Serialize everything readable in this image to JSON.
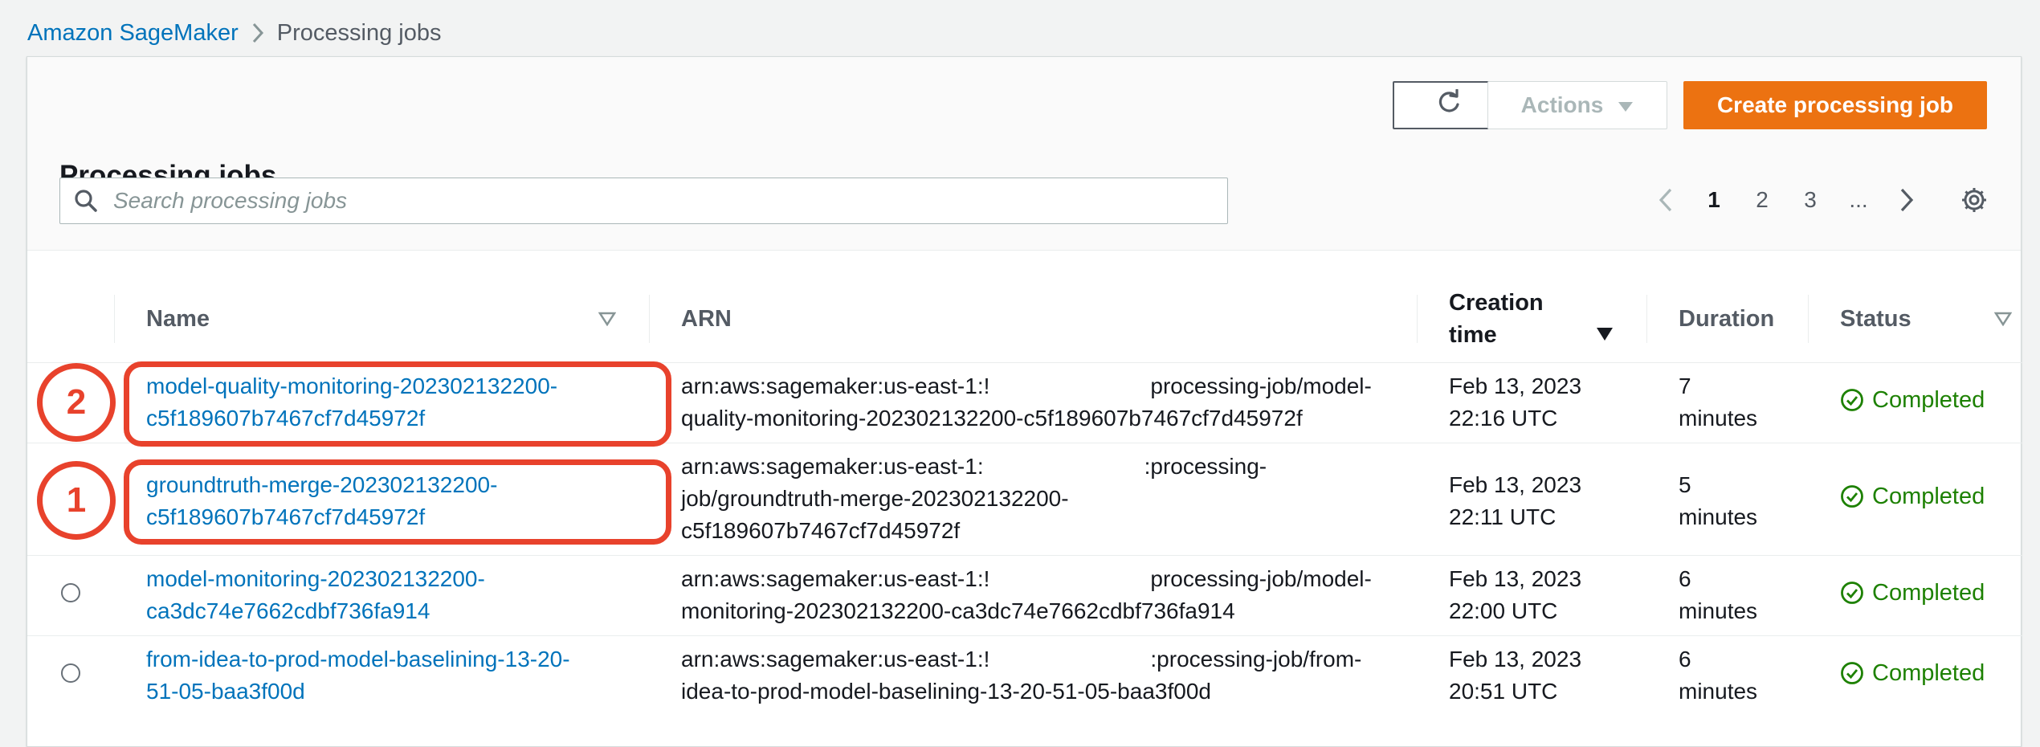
{
  "breadcrumb": {
    "root": "Amazon SageMaker",
    "current": "Processing jobs"
  },
  "panel": {
    "title": "Processing jobs"
  },
  "toolbar": {
    "refresh_icon": "refresh-icon",
    "actions_label": "Actions",
    "create_label": "Create processing job"
  },
  "search": {
    "placeholder": "Search processing jobs"
  },
  "pagination": {
    "pages": [
      "1",
      "2",
      "3",
      "..."
    ],
    "current_page": "1"
  },
  "table": {
    "headers": {
      "name": "Name",
      "arn": "ARN",
      "creation_time_1": "Creation",
      "creation_time_2": "time",
      "duration": "Duration",
      "status": "Status"
    },
    "rows": [
      {
        "name_1": "model-quality-monitoring-202302132200-",
        "name_2": "c5f189607b7467cf7d45972f",
        "arn_1a": "arn:aws:sagemaker:us-east-1:!",
        "arn_1b": "processing-job/model-",
        "arn_2": "quality-monitoring-202302132200-c5f189607b7467cf7d45972f",
        "arn_3": "",
        "time_1": "Feb 13, 2023",
        "time_2": "22:16 UTC",
        "duration_1": "7",
        "duration_2": "minutes",
        "status": "Completed",
        "callout": "2"
      },
      {
        "name_1": "groundtruth-merge-202302132200-",
        "name_2": "c5f189607b7467cf7d45972f",
        "arn_1a": "arn:aws:sagemaker:us-east-1:",
        "arn_1b": ":processing-",
        "arn_2": "job/groundtruth-merge-202302132200-",
        "arn_3": "c5f189607b7467cf7d45972f",
        "time_1": "Feb 13, 2023",
        "time_2": "22:11 UTC",
        "duration_1": "5",
        "duration_2": "minutes",
        "status": "Completed",
        "callout": "1"
      },
      {
        "name_1": "model-monitoring-202302132200-",
        "name_2": "ca3dc74e7662cdbf736fa914",
        "arn_1a": "arn:aws:sagemaker:us-east-1:!",
        "arn_1b": "processing-job/model-",
        "arn_2": "monitoring-202302132200-ca3dc74e7662cdbf736fa914",
        "arn_3": "",
        "time_1": "Feb 13, 2023",
        "time_2": "22:00 UTC",
        "duration_1": "6",
        "duration_2": "minutes",
        "status": "Completed",
        "callout": ""
      },
      {
        "name_1": "from-idea-to-prod-model-baselining-13-20-",
        "name_2": "51-05-baa3f00d",
        "arn_1a": "arn:aws:sagemaker:us-east-1:!",
        "arn_1b": ":processing-job/from-",
        "arn_2": "idea-to-prod-model-baselining-13-20-51-05-baa3f00d",
        "arn_3": "",
        "time_1": "Feb 13, 2023",
        "time_2": "20:51 UTC",
        "duration_1": "6",
        "duration_2": "minutes",
        "status": "Completed",
        "callout": ""
      }
    ]
  },
  "colors": {
    "link": "#0073bb",
    "primary_button": "#ec7211",
    "success": "#1d8102",
    "callout": "#e8422c"
  }
}
